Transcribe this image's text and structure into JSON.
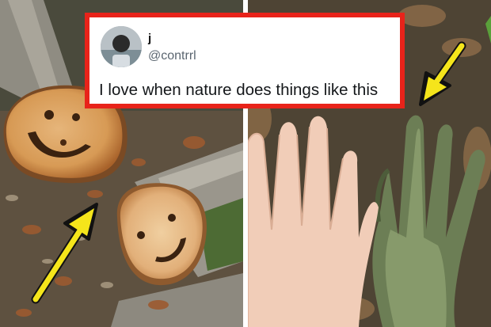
{
  "tweet": {
    "display_name": "j",
    "handle": "@contrrl",
    "text": "I love when nature does things like this"
  },
  "colors": {
    "frame_red": "#e8231a",
    "arrow_yellow": "#f5e51b"
  },
  "icons": {
    "left_arrow": "arrow-up-right-icon",
    "right_arrow": "arrow-down-left-icon"
  }
}
